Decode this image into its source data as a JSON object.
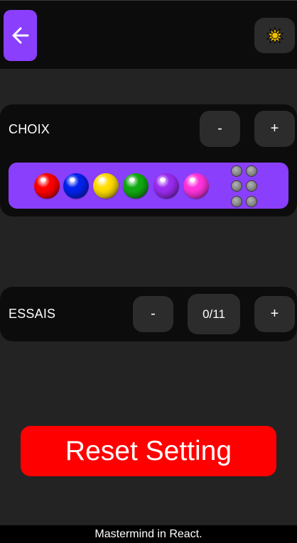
{
  "header": {
    "back_icon": "arrow-left-icon",
    "theme_icon": "sun-icon"
  },
  "choix": {
    "label": "CHOIX",
    "minus_label": "-",
    "plus_label": "+",
    "colors": [
      "#ff0000",
      "#0022ee",
      "#ffdd00",
      "#11aa11",
      "#9b2cf0",
      "#ff33dd"
    ],
    "accent": "#8a3ffc"
  },
  "essais": {
    "label": "ESSAIS",
    "minus_label": "-",
    "plus_label": "+",
    "value": "0/11"
  },
  "reset": {
    "label": "Reset Setting",
    "color": "#ff0000"
  },
  "footer": {
    "text": "Mastermind in React."
  }
}
